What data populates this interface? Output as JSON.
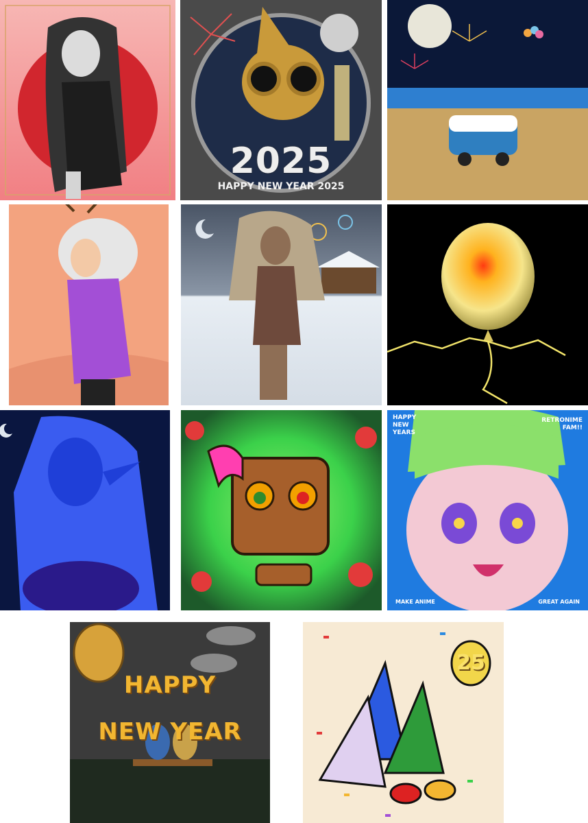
{
  "gallery": {
    "tiles": [
      {
        "id": "anime-girl-black-dress",
        "subject": "anime girl in black dress before red sun"
      },
      {
        "id": "robot-2025",
        "subject": "steampunk robot with champagne",
        "big_text": "2025",
        "caption": "HAPPY NEW YEAR 2025"
      },
      {
        "id": "beach-van",
        "subject": "van on beach under full moon and fireworks"
      },
      {
        "id": "reindeer-girl",
        "subject": "white-haired girl with antlers in purple sweater"
      },
      {
        "id": "snow-woman",
        "subject": "woman in snow with house and fireworks"
      },
      {
        "id": "glowing-balloon",
        "subject": "glowing yellow balloon on black"
      },
      {
        "id": "blue-elf",
        "subject": "blue elf girl under crescent moon"
      },
      {
        "id": "wood-mask",
        "subject": "wooden mask with ornament eyes and pink bow"
      },
      {
        "id": "anime-retro",
        "subject": "retro anime girl with star eyes",
        "texts": {
          "top_left": "HAPPY\nNEW\nYEARS",
          "top_right": "RETRONIME\nFAM!!",
          "bottom_left": "MAKE ANIME",
          "bottom_right": "GREAT AGAIN"
        }
      },
      {
        "id": "happy-new-year-bench",
        "subject": "two characters on bench under beehive",
        "line1": "HAPPY",
        "line2": "NEW YEAR"
      },
      {
        "id": "party-hats",
        "subject": "party-hat characters with confetti and 25 balloon",
        "balloon": "25"
      }
    ]
  },
  "colors": {
    "red_sun": "#d1262e",
    "pink_bg": "#f7a3a3",
    "gold": "#c99a3a",
    "night_sky": "#0b1838",
    "sand": "#c9a463",
    "salmon": "#f3a37f",
    "purple": "#a34fd6",
    "snow": "#e8eef4",
    "black": "#000000",
    "balloon_yellow": "#f6e58b",
    "elf_blue": "#1f3fd8",
    "green_glow": "#3bd14a",
    "wood": "#a65f2b",
    "hot_pink": "#ff3fb0",
    "anime_blue": "#1f7be0",
    "anime_green": "#8be06b",
    "dark_grey": "#3b3b3b",
    "hny_orange": "#f2b631",
    "cream": "#f7ead4"
  }
}
